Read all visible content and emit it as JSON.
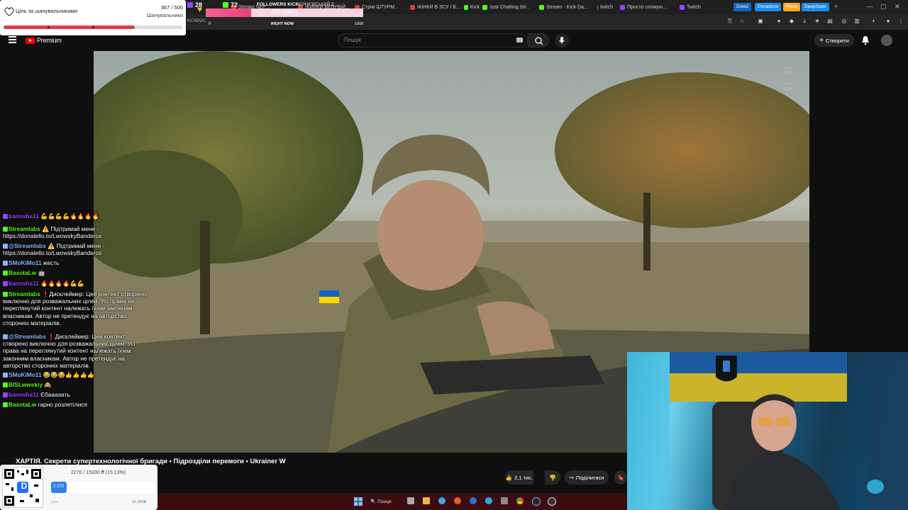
{
  "browser": {
    "tabs": [
      {
        "label": "Stream ЧЕР...",
        "color": "#e53935"
      },
      {
        "label": "ЖИНКИ ВЕЗУВІЙ...",
        "color": "#e53935"
      },
      {
        "label": "Стрім ШТУРМ...",
        "color": "#e53935"
      },
      {
        "label": "ЖІНКИ В ЗСУ / Б...",
        "color": "#e53935"
      },
      {
        "label": "Kick",
        "color": "#53fc18"
      },
      {
        "label": "Just Chatting Str...",
        "color": "#53fc18"
      },
      {
        "label": "Stream - Kick Da...",
        "color": "#53fc18"
      },
      {
        "label": "twitch",
        "color": "#9146ff"
      },
      {
        "label": "Просто спілкую...",
        "color": "#9146ff"
      },
      {
        "label": "Twitch",
        "color": "#9146ff"
      }
    ],
    "bookmarks": [
      {
        "label": "Dota2",
        "color": "#1565c0"
      },
      {
        "label": "Donations",
        "color": "#1e88e5"
      },
      {
        "label": "Films",
        "color": "#f9a825"
      },
      {
        "label": "DeepState",
        "color": "#1e88e5"
      }
    ],
    "new_tab": "+",
    "address_fragment": "KC4ByN..."
  },
  "youtube": {
    "logo_text": "Premium",
    "search_placeholder": "Пошук",
    "create_label": "Створити",
    "video_title": "ХАРТІЯ. Секрети супертехнологічної бригади • Підрозділи перемоги • Ukrainer W",
    "likes": "2,1 тис.",
    "share_label": "Поділитися",
    "rtx_badges": [
      "RTX VSR",
      "RTX HDR"
    ]
  },
  "goal_widget": {
    "title": "Ціль за шанувальниками",
    "current": "367",
    "total": "500",
    "counter": "367 / 500",
    "sublabel": "Шанувальники",
    "progress": 0.734,
    "accent": "#e8394d"
  },
  "followers_widget": {
    "twitch_count": "28",
    "kick_count": "72",
    "title": "FOLLOWERS KICK",
    "bar_text": "289 (28%)",
    "progress": 0.289,
    "min": "0",
    "max": "1000",
    "status": "RIGHT NOW",
    "ticker": "ЧЕРНІГІВСЬКИЙ Д"
  },
  "chat": [
    {
      "user": "bannsha11",
      "color": "#9146ff",
      "text": "💪💪💪💪🔥🔥🔥🔥"
    },
    {
      "user": "Streamlabs",
      "color": "#53fc18",
      "text": "⚠️ Підтримай мене - https://donatello.to/LwowskyBanderos"
    },
    {
      "user": "@Streamlabs",
      "color": "#8ab4ff",
      "text": "⚠️ Підтримай мене - https://donatello.to/LwowskyBanderos"
    },
    {
      "user": "SMoKiMo11",
      "color": "#8ab4ff",
      "text": "жесть"
    },
    {
      "user": "BasotaLw",
      "color": "#53fc18",
      "text": "🤖"
    },
    {
      "user": "bannsha11",
      "color": "#9146ff",
      "text": "🔥🔥🔥🔥💪💪"
    },
    {
      "user": "Streamlabs",
      "color": "#53fc18",
      "text": "❗Дисклеймер: Цей контент створено виключно для розважальних цілей. Усі права на переглянутий контент належать їхнім законним власникам. Автор не претендує на авторство сторонніх матеріалів."
    },
    {
      "user": "@Streamlabs",
      "color": "#8ab4ff",
      "text": "❗Дисклеймер: Цей контент створено виключно для розважальних цілей. Усі права на переглянутий контент належать їхнім законним власникам. Автор не претендує на авторство сторонніх матеріалів."
    },
    {
      "user": "SMoKiMo11",
      "color": "#8ab4ff",
      "text": "😂😂😂👍👍👍👍"
    },
    {
      "user": "BISLwwskiy",
      "color": "#53fc18",
      "text": "🙈"
    },
    {
      "user": "bannsha11",
      "color": "#9146ff",
      "text": "Єбааааать"
    },
    {
      "user": "BasotaLw",
      "color": "#53fc18",
      "text": "гарно розлетілися"
    }
  ],
  "donation_widget": {
    "label": "2270 / 15000 ₴ (15.13%)",
    "bar_value": "2 270",
    "progress": 0.1513,
    "min_label": "Ціль",
    "max_label": "15 000₴",
    "qr_letter": "D"
  },
  "taskbar": {
    "search_label": "Пошук"
  }
}
